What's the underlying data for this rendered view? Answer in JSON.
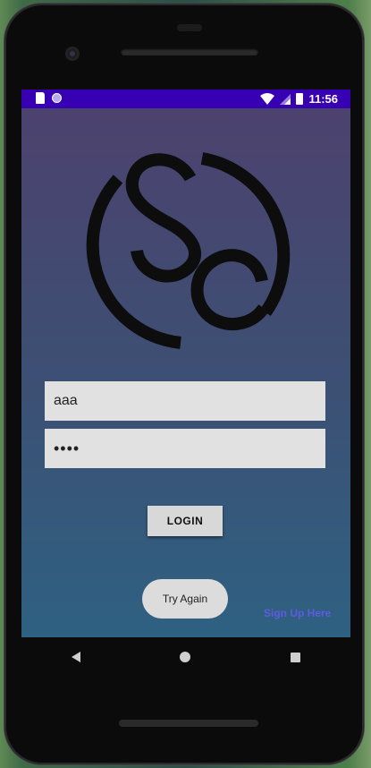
{
  "status_bar": {
    "time": "11:56",
    "icons": [
      "sd-card-icon",
      "notification-dot-icon",
      "wifi-icon",
      "cell-signal-icon",
      "battery-icon"
    ]
  },
  "logo": {
    "monogram": "SC",
    "color": "#0d0d0d"
  },
  "login_form": {
    "username_value": "aaa",
    "password_value": "••••",
    "login_label": "LOGIN",
    "try_again_label": "Try Again",
    "signup_label": "Sign Up Here"
  },
  "colors": {
    "status_bar": "#3700b3",
    "gradient_top": "#4d416e",
    "gradient_bottom": "#2e6182",
    "signup_link": "#5f5be0",
    "field_bg": "#e1e1e1"
  },
  "nav_bar": {
    "icons": [
      "back-icon",
      "home-icon",
      "recents-icon"
    ]
  }
}
